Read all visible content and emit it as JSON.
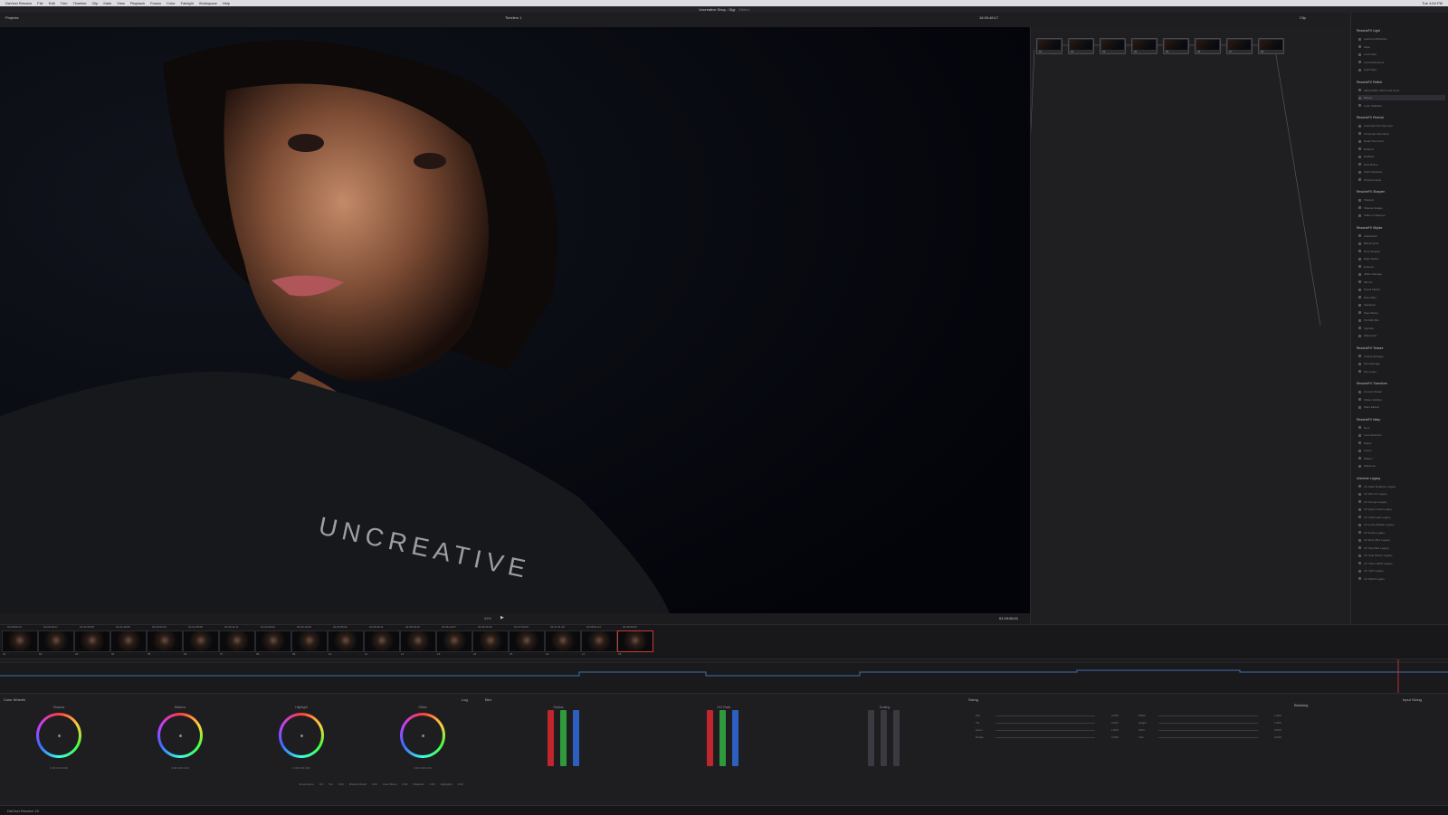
{
  "menubar": {
    "items": [
      "DaVinci Resolve",
      "File",
      "Edit",
      "Trim",
      "Timeline",
      "Clip",
      "Mark",
      "View",
      "Playback",
      "Fusion",
      "Color",
      "Fairlight",
      "Workspace",
      "Help"
    ],
    "clock": "Tue 4:54 PM"
  },
  "window": {
    "project": "Projects",
    "title": "Uncreative Shop - Digi",
    "subtitle": "Edited",
    "timeline_name": "Timeline 1",
    "timecode_top": "16:26:48:17"
  },
  "toolbar": {
    "right_tabs": [
      "Clips",
      "Nodes",
      "OpenFX"
    ],
    "clip_mode": "Clip",
    "library_tab": "Library"
  },
  "viewer": {
    "timecode": "01:19:06:21",
    "zoom": "39%",
    "watermark": "UNCREATIVE"
  },
  "nodes": [
    {
      "label": "01"
    },
    {
      "label": "02"
    },
    {
      "label": "03"
    },
    {
      "label": "04"
    },
    {
      "label": "05"
    },
    {
      "label": "06"
    },
    {
      "label": "07"
    },
    {
      "label": "08"
    }
  ],
  "library": {
    "sections": [
      {
        "title": "ResolveFX Light",
        "items": [
          "Aperture Diffraction",
          "Glow",
          "Lens Flare",
          "Lens Reflections",
          "Light Rays"
        ]
      },
      {
        "title": "ResolveFX Refine",
        "items": [
          "Alpha Matte Shrink and Grow",
          "Beauty",
          "Color Stabilizer"
        ]
      },
      {
        "title": "ResolveFX Revival",
        "items": [
          "Automatic Dirt Removal",
          "Chromatic Aberration",
          "Dead Pixel Fixer",
          "Deband",
          "Deflicker",
          "Dust Buster",
          "Patch Replacer",
          "Chroma Noise"
        ]
      },
      {
        "title": "ResolveFX Sharpen",
        "items": [
          "Sharpen",
          "Sharpen Edges",
          "Soften & Sharpen"
        ]
      },
      {
        "title": "ResolveFX Stylize",
        "items": [
          "Abstraction",
          "Blanking Fill",
          "Drop Shadow",
          "Edge Detect",
          "Emboss",
          "JPEG Damage",
          "Mirrors",
          "Pencil Sketch",
          "Prism Blur",
          "Scanlines",
          "Stop Motion",
          "Tilt-Shift Blur",
          "Vignette",
          "Watercolor"
        ]
      },
      {
        "title": "ResolveFX Texture",
        "items": [
          "Analog Damage",
          "Film Damage",
          "Film Grain"
        ]
      },
      {
        "title": "ResolveFX Transform",
        "items": [
          "Camera Shake",
          "Flicker Addition",
          "Warp Effects"
        ]
      },
      {
        "title": "ResolveFX Warp",
        "items": [
          "Dent",
          "Lens Distortion",
          "Ripple",
          "Vortex",
          "Warper",
          "Waviness"
        ]
      },
      {
        "title": "Universe Legacy",
        "items": [
          "UV Flash Reflector Legacy",
          "UV Film FX Legacy",
          "UV Grunge Legacy",
          "UV Hyper Glow Legacy",
          "UV Light Leak Legacy",
          "UV Looks Builder Legacy",
          "UV Noise Legacy",
          "UV Retro Blur Legacy",
          "UV Spot Blur Legacy",
          "UV Stop Motion Legacy",
          "UV Video Glitch Legacy",
          "UV VHS Legacy",
          "UV Wash Legacy"
        ]
      }
    ],
    "selected": "Beauty"
  },
  "clips": [
    {
      "tc": "01:00:00:13",
      "n": "01"
    },
    {
      "tc": "01:00:48:17",
      "n": "02"
    },
    {
      "tc": "01:01:05:08",
      "n": "03"
    },
    {
      "tc": "01:01:20:05",
      "n": "04"
    },
    {
      "tc": "01:02:03:22",
      "n": "05"
    },
    {
      "tc": "01:02:28:08",
      "n": "06"
    },
    {
      "tc": "01:03:11:11",
      "n": "07"
    },
    {
      "tc": "01:03:40:04",
      "n": "08"
    },
    {
      "tc": "01:04:10:09",
      "n": "09"
    },
    {
      "tc": "01:04:55:02",
      "n": "10"
    },
    {
      "tc": "01:05:20:11",
      "n": "11"
    },
    {
      "tc": "01:05:49:15",
      "n": "12"
    },
    {
      "tc": "01:06:12:07",
      "n": "13"
    },
    {
      "tc": "01:06:40:20",
      "n": "14"
    },
    {
      "tc": "01:07:03:03",
      "n": "15"
    },
    {
      "tc": "01:07:31:19",
      "n": "16"
    },
    {
      "tc": "01:08:02:14",
      "n": "17"
    },
    {
      "tc": "01:08:30:06",
      "n": "18"
    }
  ],
  "color": {
    "panel_title": "Color Wheels",
    "mode": "Log",
    "wheels": [
      {
        "name": "Shadow",
        "vals": "0.00   0.00   0.00"
      },
      {
        "name": "Midtone",
        "vals": "0.00   0.00   0.00"
      },
      {
        "name": "Highlight",
        "vals": "0.00   0.00   0.00"
      },
      {
        "name": "Offset",
        "vals": "0.00   0.00   0.00"
      }
    ],
    "blur_title": "Blur",
    "radius_label": "Radius",
    "hv_label": "H/V Ratio",
    "scaling_label": "Scaling",
    "blur_vals": [
      "0.50",
      "0.50",
      "0.50"
    ],
    "key_title": "Blur",
    "sizing_title": "Sizing",
    "sizing_mode": "Input Sizing",
    "sizing_rows": [
      {
        "label": "Pan",
        "val": "0.000"
      },
      {
        "label": "Tilt",
        "val": "0.000"
      },
      {
        "label": "Zoom",
        "val": "1.000"
      },
      {
        "label": "Rotate",
        "val": "0.000"
      },
      {
        "label": "Width",
        "val": "1.000"
      },
      {
        "label": "Height",
        "val": "1.000"
      },
      {
        "label": "Pitch",
        "val": "0.000"
      },
      {
        "label": "Yaw",
        "val": "0.000"
      }
    ],
    "blanking_title": "Blanking",
    "footer": {
      "temp_label": "Temperature",
      "temp": "0.0",
      "tint_label": "Tint",
      "tint": "0.00",
      "md_label": "Midtone Detail",
      "md": "0.00",
      "boost_label": "Color Boost",
      "boost": "0.00",
      "shadows_label": "Shadows",
      "shadows": "0.00",
      "hl_label": "Highlights",
      "hl": "0.00"
    }
  },
  "status": {
    "app": "DaVinci Resolve 15"
  }
}
